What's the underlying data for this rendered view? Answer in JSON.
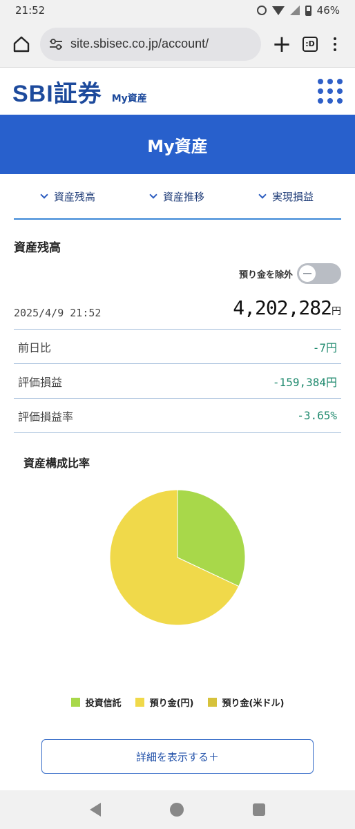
{
  "status_bar": {
    "time": "21:52",
    "battery": "46%"
  },
  "browser": {
    "url": "site.sbisec.co.jp/account/",
    "plus": "+",
    "tabs_label": ":D"
  },
  "site": {
    "logo": "SBI証券",
    "subtitle": "My資産"
  },
  "banner": {
    "title": "My資産"
  },
  "tabs": [
    {
      "label": "資産残高"
    },
    {
      "label": "資産推移"
    },
    {
      "label": "実現損益"
    }
  ],
  "balance": {
    "title": "資産残高",
    "toggle_label": "預り金を除外",
    "toggle_on": false,
    "date": "2025/4/9 21:52",
    "total": "4,202,282",
    "unit": "円",
    "metrics": [
      {
        "label": "前日比",
        "value": "-7円"
      },
      {
        "label": "評価損益",
        "value": "-159,384円"
      },
      {
        "label": "評価損益率",
        "value": "-3.65%"
      }
    ]
  },
  "composition": {
    "title": "資産構成比率",
    "legend": [
      {
        "label": "投資信託",
        "color": "#a8d84a"
      },
      {
        "label": "預り金(円)",
        "color": "#f0d94a"
      },
      {
        "label": "預り金(米ドル)",
        "color": "#d6c23c"
      }
    ],
    "detail_button": "詳細を表示する＋"
  },
  "chart_data": {
    "type": "pie",
    "categories": [
      "投資信託",
      "預り金(円)",
      "預り金(米ドル)"
    ],
    "values": [
      32,
      68,
      0
    ],
    "colors": [
      "#a8d84a",
      "#f0d94a",
      "#d6c23c"
    ],
    "title": "資産構成比率"
  }
}
